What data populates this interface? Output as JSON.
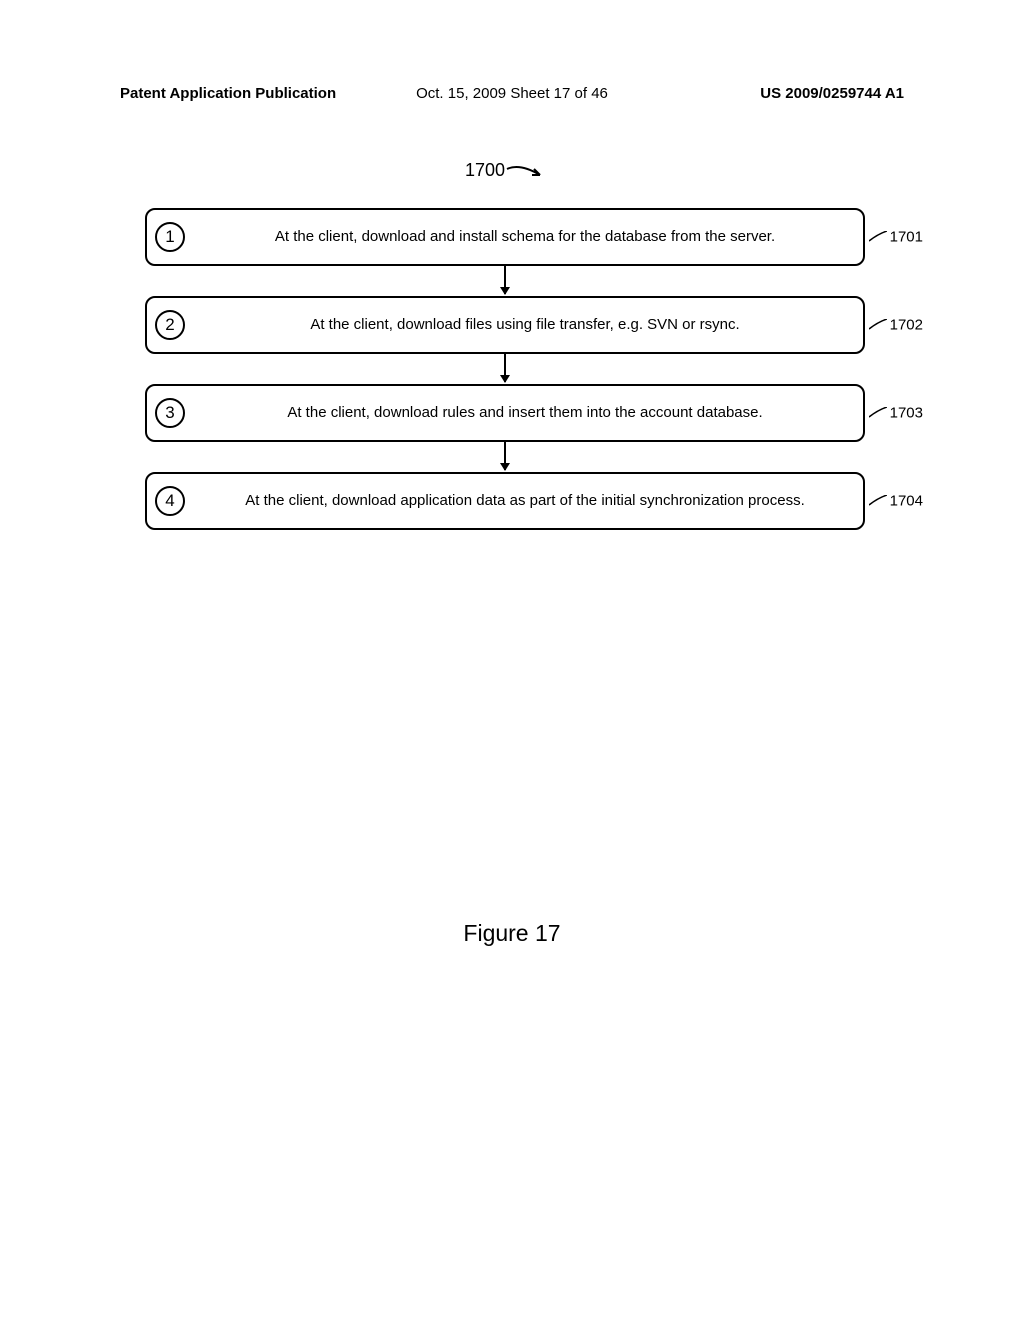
{
  "header": {
    "left": "Patent Application Publication",
    "center": "Oct. 15, 2009  Sheet 17 of 46",
    "right": "US 2009/0259744 A1"
  },
  "diagram": {
    "fig_number": "1700",
    "steps": [
      {
        "num": "1",
        "text": "At the client, download and install schema for the database from the server.",
        "ref": "1701"
      },
      {
        "num": "2",
        "text": "At the client, download files using file transfer, e.g. SVN or rsync.",
        "ref": "1702"
      },
      {
        "num": "3",
        "text": "At the client, download rules and insert them into the account database.",
        "ref": "1703"
      },
      {
        "num": "4",
        "text": "At the client, download application data as part of the initial synchronization process.",
        "ref": "1704"
      }
    ]
  },
  "figure_caption": "Figure 17"
}
